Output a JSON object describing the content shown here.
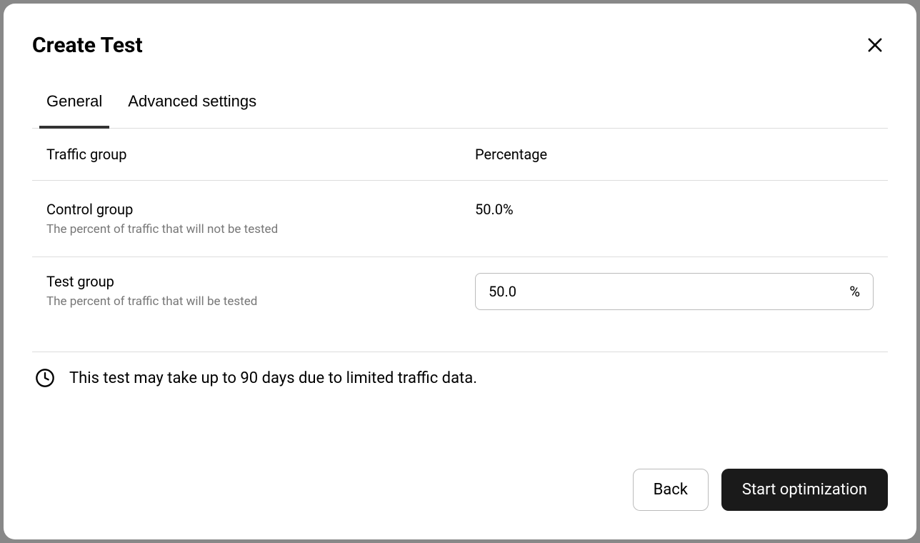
{
  "modal": {
    "title": "Create Test"
  },
  "tabs": {
    "general": "General",
    "advanced": "Advanced settings"
  },
  "table": {
    "headers": {
      "group": "Traffic group",
      "percentage": "Percentage"
    },
    "rows": {
      "control": {
        "title": "Control group",
        "desc": "The percent of traffic that will not be tested",
        "value": "50.0%"
      },
      "test": {
        "title": "Test group",
        "desc": "The percent of traffic that will be tested",
        "input_value": "50.0",
        "suffix": "%"
      }
    }
  },
  "notice": "This test may take up to 90 days due to limited traffic data.",
  "buttons": {
    "back": "Back",
    "start": "Start optimization"
  }
}
